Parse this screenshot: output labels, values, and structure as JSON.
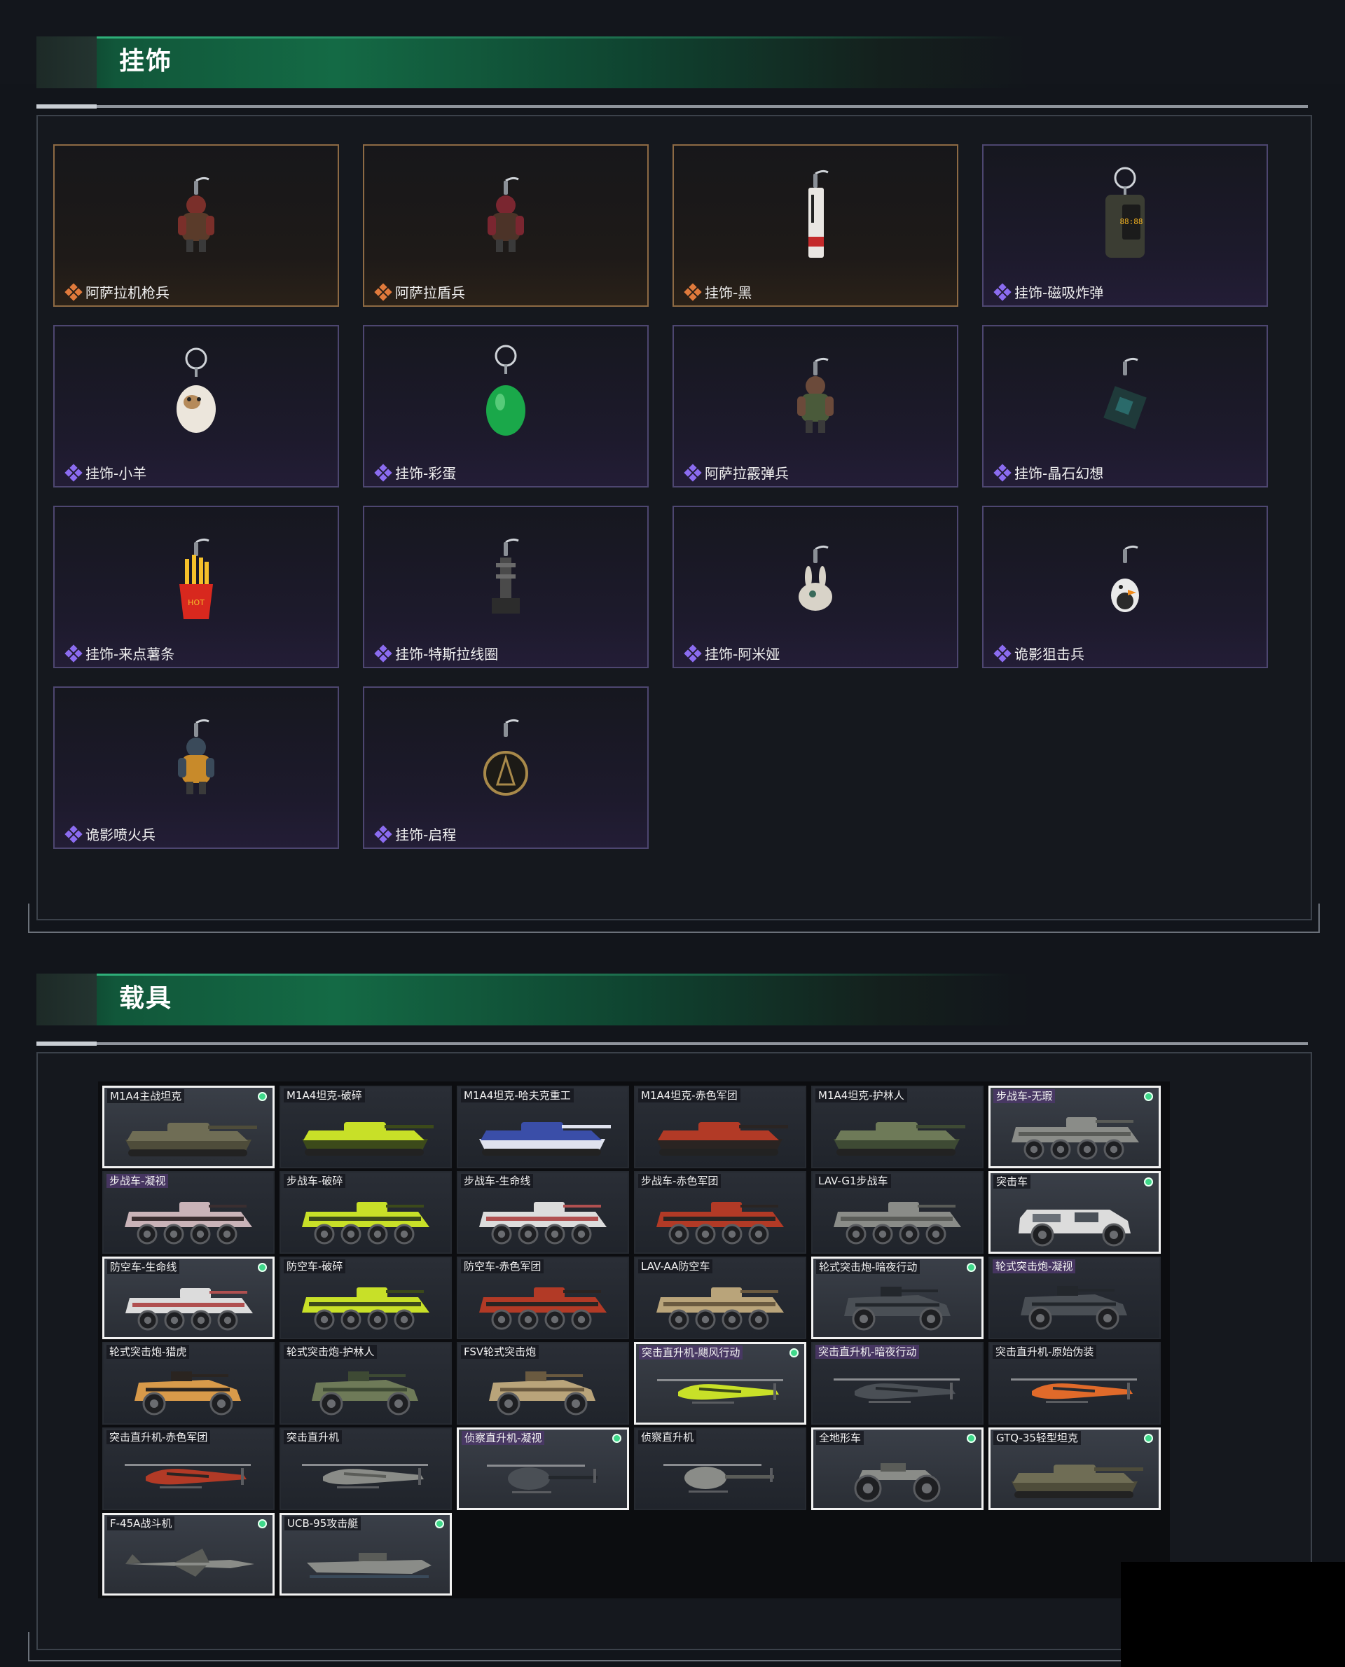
{
  "sections": {
    "charms": {
      "title": "挂饰",
      "items": [
        {
          "label": "阿萨拉机枪兵",
          "rarity": "legendary"
        },
        {
          "label": "阿萨拉盾兵",
          "rarity": "legendary"
        },
        {
          "label": "挂饰-黑",
          "rarity": "legendary"
        },
        {
          "label": "挂饰-磁吸炸弹",
          "rarity": "epic"
        },
        {
          "label": "挂饰-小羊",
          "rarity": "epic"
        },
        {
          "label": "挂饰-彩蛋",
          "rarity": "epic"
        },
        {
          "label": "阿萨拉霰弹兵",
          "rarity": "epic"
        },
        {
          "label": "挂饰-晶石幻想",
          "rarity": "epic"
        },
        {
          "label": "挂饰-来点薯条",
          "rarity": "epic"
        },
        {
          "label": "挂饰-特斯拉线圈",
          "rarity": "epic"
        },
        {
          "label": "挂饰-阿米娅",
          "rarity": "epic"
        },
        {
          "label": "诡影狙击兵",
          "rarity": "epic"
        },
        {
          "label": "诡影喷火兵",
          "rarity": "epic"
        },
        {
          "label": "挂饰-启程",
          "rarity": "epic"
        }
      ]
    },
    "vehicles": {
      "title": "载具",
      "items": [
        {
          "label": "M1A4主战坦克",
          "owned": true,
          "kind": "tank",
          "camo": "olive"
        },
        {
          "label": "M1A4坦克-破碎",
          "owned": false,
          "kind": "tank",
          "camo": "lime"
        },
        {
          "label": "M1A4坦克-哈夫克重工",
          "owned": false,
          "kind": "tank",
          "camo": "blue"
        },
        {
          "label": "M1A4坦克-赤色军团",
          "owned": false,
          "kind": "tank",
          "camo": "red"
        },
        {
          "label": "M1A4坦克-护林人",
          "owned": false,
          "kind": "tank",
          "camo": "forest"
        },
        {
          "label": "步战车-无瑕",
          "owned": true,
          "kind": "ifv",
          "camo": "grey",
          "highlight": true
        },
        {
          "label": "步战车-凝视",
          "owned": false,
          "kind": "ifv",
          "camo": "pink",
          "highlight": true
        },
        {
          "label": "步战车-破碎",
          "owned": false,
          "kind": "ifv",
          "camo": "lime"
        },
        {
          "label": "步战车-生命线",
          "owned": false,
          "kind": "ifv",
          "camo": "white"
        },
        {
          "label": "步战车-赤色军团",
          "owned": false,
          "kind": "ifv",
          "camo": "red"
        },
        {
          "label": "LAV-G1步战车",
          "owned": false,
          "kind": "ifv",
          "camo": "grey"
        },
        {
          "label": "突击车",
          "owned": true,
          "kind": "mrap",
          "camo": "white"
        },
        {
          "label": "防空车-生命线",
          "owned": true,
          "kind": "ifv",
          "camo": "white"
        },
        {
          "label": "防空车-破碎",
          "owned": false,
          "kind": "ifv",
          "camo": "lime"
        },
        {
          "label": "防空车-赤色军团",
          "owned": false,
          "kind": "ifv",
          "camo": "red"
        },
        {
          "label": "LAV-AA防空车",
          "owned": false,
          "kind": "ifv",
          "camo": "sand"
        },
        {
          "label": "轮式突击炮-暗夜行动",
          "owned": true,
          "kind": "buggy",
          "camo": "dark"
        },
        {
          "label": "轮式突击炮-凝视",
          "owned": false,
          "kind": "buggy",
          "camo": "dark",
          "highlight": true
        },
        {
          "label": "轮式突击炮-猎虎",
          "owned": false,
          "kind": "buggy",
          "camo": "tiger"
        },
        {
          "label": "轮式突击炮-护林人",
          "owned": false,
          "kind": "buggy",
          "camo": "forest"
        },
        {
          "label": "FSV轮式突击炮",
          "owned": false,
          "kind": "buggy",
          "camo": "sand"
        },
        {
          "label": "突击直升机-飓风行动",
          "owned": true,
          "kind": "heli",
          "camo": "lime",
          "highlight": true
        },
        {
          "label": "突击直升机-暗夜行动",
          "owned": false,
          "kind": "heli",
          "camo": "dark",
          "highlight": true
        },
        {
          "label": "突击直升机-原始伪装",
          "owned": false,
          "kind": "heli",
          "camo": "orange"
        },
        {
          "label": "突击直升机-赤色军团",
          "owned": false,
          "kind": "heli",
          "camo": "red"
        },
        {
          "label": "突击直升机",
          "owned": false,
          "kind": "heli",
          "camo": "grey"
        },
        {
          "label": "侦察直升机-凝视",
          "owned": true,
          "kind": "scout",
          "camo": "dark",
          "highlight": true
        },
        {
          "label": "侦察直升机",
          "owned": false,
          "kind": "scout",
          "camo": "grey"
        },
        {
          "label": "全地形车",
          "owned": true,
          "kind": "atv",
          "camo": "grey"
        },
        {
          "label": "GTQ-35轻型坦克",
          "owned": true,
          "kind": "tank",
          "camo": "olive"
        },
        {
          "label": "F-45A战斗机",
          "owned": true,
          "kind": "jet",
          "camo": "grey"
        },
        {
          "label": "UCB-95攻击艇",
          "owned": true,
          "kind": "boat",
          "camo": "grey"
        }
      ]
    }
  },
  "colors": {
    "legendary_border": "#8d6a44",
    "legendary_icon": "#e07a3c",
    "epic_border": "#4d4670",
    "epic_icon": "#8b6cf0",
    "owned_dot": "#3fd98a",
    "header_green": "#146a45"
  }
}
